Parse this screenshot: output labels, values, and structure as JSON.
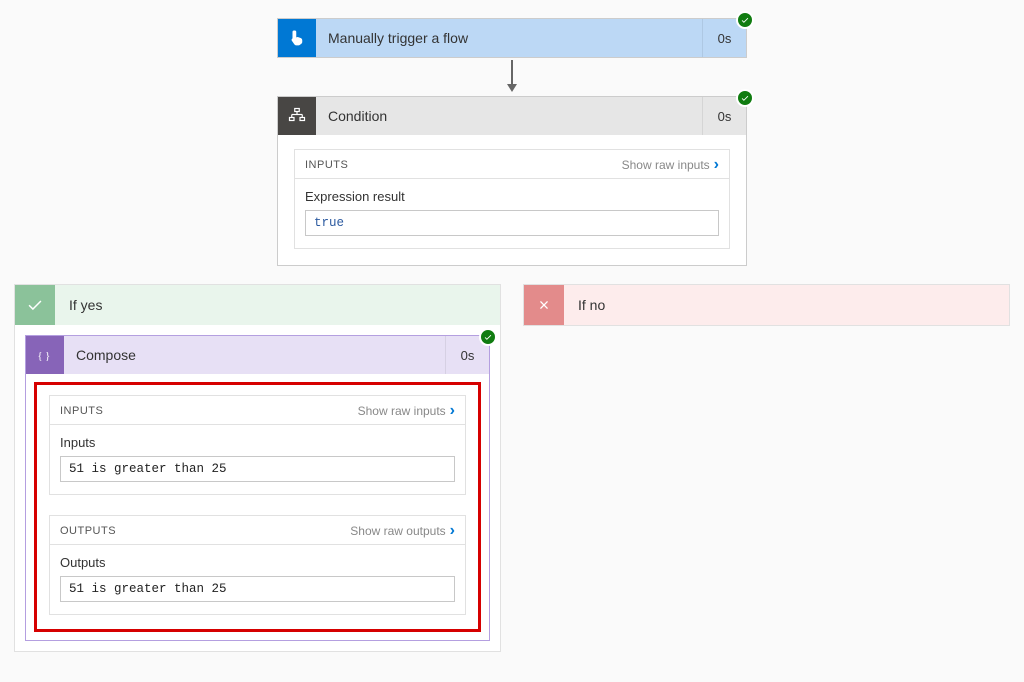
{
  "trigger": {
    "title": "Manually trigger a flow",
    "duration": "0s"
  },
  "condition": {
    "title": "Condition",
    "duration": "0s",
    "inputs_header": "INPUTS",
    "show_raw_inputs": "Show raw inputs",
    "expr_label": "Expression result",
    "expr_value": "true"
  },
  "branches": {
    "yes_label": "If yes",
    "no_label": "If no"
  },
  "compose": {
    "title": "Compose",
    "duration": "0s",
    "inputs_header": "INPUTS",
    "show_raw_inputs": "Show raw inputs",
    "inputs_label": "Inputs",
    "inputs_value": "51 is greater than 25",
    "outputs_header": "OUTPUTS",
    "show_raw_outputs": "Show raw outputs",
    "outputs_label": "Outputs",
    "outputs_value": "51 is greater than 25"
  }
}
